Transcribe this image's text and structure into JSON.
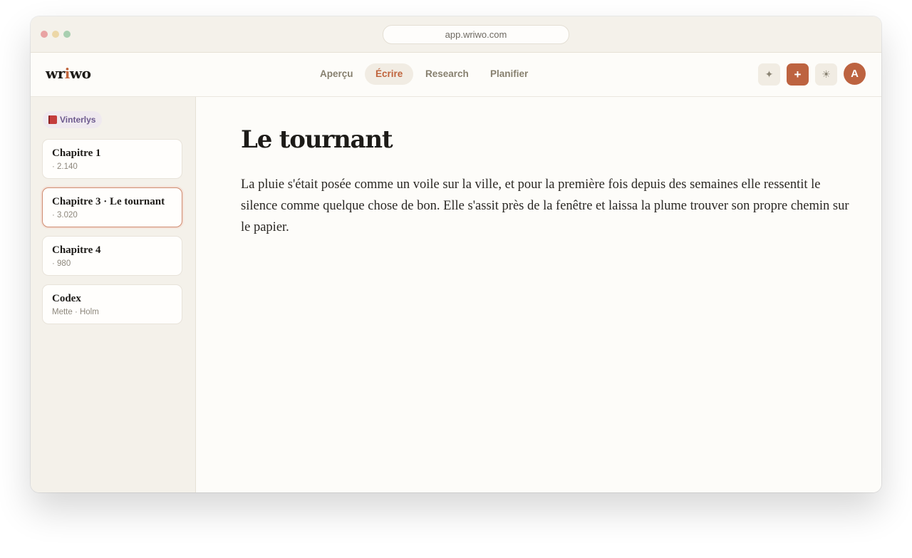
{
  "browser": {
    "url": "app.wriwo.com",
    "traffic_lights": [
      "#e9a3a3",
      "#ecd7a7",
      "#a8cfb0"
    ]
  },
  "header": {
    "logo_prefix": "wr",
    "logo_accent": "i",
    "logo_suffix": "wo",
    "tabs": [
      {
        "label": "Aperçu",
        "active": false
      },
      {
        "label": "Écrire",
        "active": true
      },
      {
        "label": "Research",
        "active": false
      },
      {
        "label": "Planifier",
        "active": false
      }
    ],
    "actions": {
      "sparkle_icon": "✦",
      "add_icon": "+",
      "theme_icon": "☀",
      "avatar_initial": "A"
    }
  },
  "sidebar": {
    "project": "Vinterlys",
    "items": [
      {
        "title": "Chapitre 1",
        "meta": "· 2.140",
        "active": false
      },
      {
        "title": "Chapitre 3 · Le tournant",
        "meta": "· 3.020",
        "active": true
      },
      {
        "title": "Chapitre 4",
        "meta": "· 980",
        "active": false
      },
      {
        "title": "Codex",
        "meta": "Mette · Holm",
        "active": false
      }
    ]
  },
  "editor": {
    "title": "Le tournant",
    "body": "La pluie s'était posée comme un voile sur la ville, et pour la première fois depuis des semaines elle ressentit le silence comme quelque chose de bon. Elle s'assit près de la fenêtre et laissa la plume trouver son propre chemin sur le papier."
  },
  "colors": {
    "accent": "#bd6340",
    "background": "#fdfcf9",
    "sidebar": "#f4f1ea"
  }
}
